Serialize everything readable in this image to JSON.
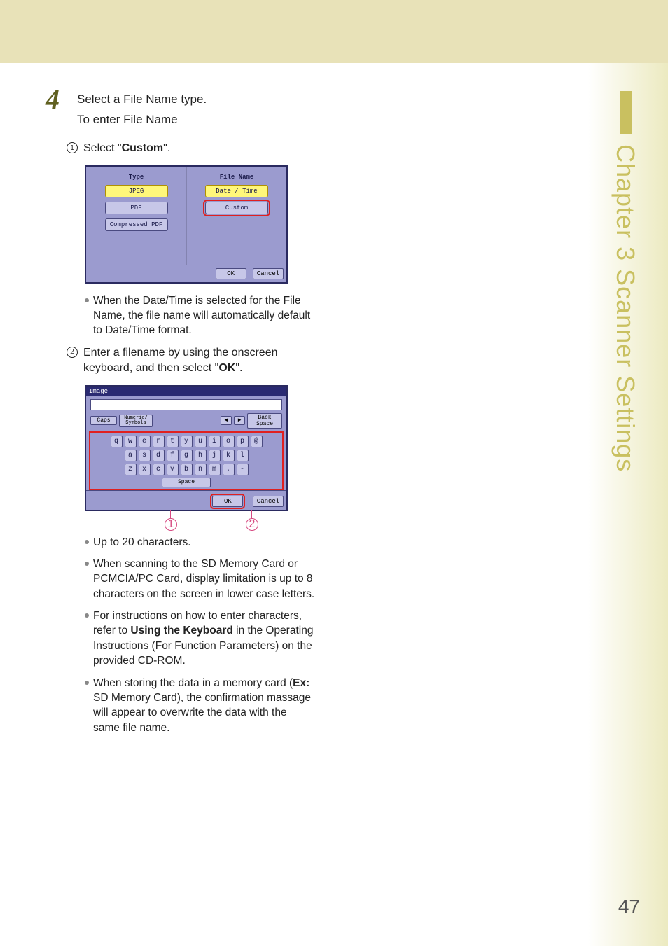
{
  "step_number": "4",
  "step_line1": "Select a File Name type.",
  "step_line2": "To enter File Name",
  "sub1_num": "1",
  "sub1_text_pre": "Select \"",
  "sub1_bold": "Custom",
  "sub1_text_post": "\".",
  "shot1": {
    "type_label": "Type",
    "jpeg": "JPEG",
    "pdf": "PDF",
    "cpdf": "Compressed PDF",
    "filename_label": "File Name",
    "datetime": "Date / Time",
    "custom": "Custom",
    "ok": "OK",
    "cancel": "Cancel"
  },
  "bullet1": "When the Date/Time is selected for the File Name, the file name will automatically default to Date/Time format.",
  "sub2_num": "2",
  "sub2_text_pre": "Enter a filename by using the onscreen keyboard, and then select \"",
  "sub2_bold": "OK",
  "sub2_text_post": "\".",
  "kb": {
    "title": "Image",
    "caps": "Caps",
    "numeric": "Numeric/\nSymbols",
    "back": "Back Space",
    "row1": [
      "q",
      "w",
      "e",
      "r",
      "t",
      "y",
      "u",
      "i",
      "o",
      "p",
      "@"
    ],
    "row2": [
      "a",
      "s",
      "d",
      "f",
      "g",
      "h",
      "j",
      "k",
      "l"
    ],
    "row3": [
      "z",
      "x",
      "c",
      "v",
      "b",
      "n",
      "m",
      ".",
      "-"
    ],
    "space": "Space",
    "ok": "OK",
    "cancel": "Cancel"
  },
  "callout1": "1",
  "callout2": "2",
  "bullets_after": {
    "b1": "Up to 20 characters.",
    "b2": "When scanning to the SD Memory Card or PCMCIA/PC Card, display limitation is up to 8 characters on the screen in lower case letters.",
    "b3_pre": "For instructions on how to enter characters, refer to ",
    "b3_bold": "Using the Keyboard",
    "b3_post": " in the Operating Instructions (For Function Parameters) on the provided CD-ROM.",
    "b4_pre": "When storing the data in a memory card (",
    "b4_bold": "Ex:",
    "b4_post": " SD Memory Card), the confirmation massage will appear to overwrite the data with the same file name."
  },
  "chapter": "Chapter 3",
  "chapter_spacer": "   ",
  "section": "Scanner Settings",
  "page_number": "47"
}
